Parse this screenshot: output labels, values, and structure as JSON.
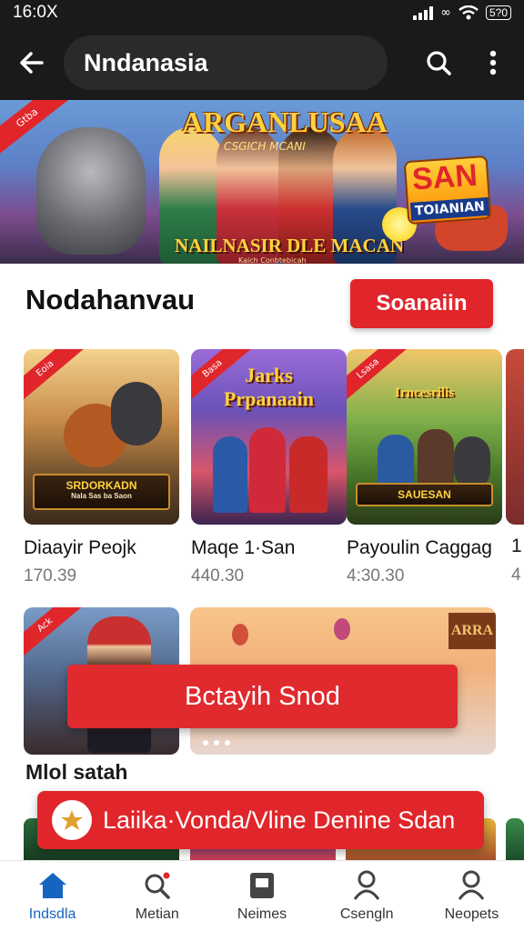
{
  "status_bar": {
    "time": "16:0X",
    "battery": "5?0"
  },
  "app_bar": {
    "title": "Nndanasia",
    "icons": [
      "back-arrow-icon",
      "search-icon",
      "more-vert-icon"
    ]
  },
  "hero_banner": {
    "title": "ARGANLUSAA",
    "subtitle": "CSGICH MCANI",
    "bottom_text": "NAILNASIR DLE MACAN",
    "small_text": "Kaich Conbtebicah",
    "badge_top": "SAN",
    "badge_bottom": "TOIANIAN",
    "corner": "Gtba"
  },
  "section": {
    "title": "Nodahanvau",
    "see_all_label": "Soanaiin"
  },
  "games": [
    {
      "name": "Diaayir Peojk",
      "price": "170.39",
      "corner": "Eoia",
      "caption": "",
      "plate": "SRDORKADN",
      "plate_sub": "Nala Sas ba Saon"
    },
    {
      "name": "Maqe 1·San",
      "price": "440.30",
      "corner": "Basa",
      "caption": "Jarks Prpanaain",
      "plate": "",
      "plate_sub": ""
    },
    {
      "name": "Payoulin Caggag",
      "price": "4:30.30",
      "corner": "Lsasa",
      "caption": "Irncesrilis",
      "plate": "SAUESAN",
      "plate_sub": ""
    },
    {
      "name": "1",
      "price": "4"
    }
  ],
  "promo_row": {
    "corner": "Ack",
    "right_sign": "ARRA"
  },
  "overlay_banner": {
    "label": "Bctayih Snod"
  },
  "subsection": {
    "title": "Mlol satah"
  },
  "cta": {
    "label": "Laiika·Vonda/Vline Denine Sdan"
  },
  "bottom_nav": [
    {
      "label": "Indsdla",
      "icon": "home-icon",
      "active": true
    },
    {
      "label": "Metian",
      "icon": "search-badge-icon",
      "active": false
    },
    {
      "label": "Neimes",
      "icon": "gamepad-icon",
      "active": false
    },
    {
      "label": "Csengln",
      "icon": "person-icon",
      "active": false
    },
    {
      "label": "Neopets",
      "icon": "account-icon",
      "active": false
    }
  ],
  "colors": {
    "accent": "#e0262b",
    "nav_active": "#1565c0",
    "dark_bar": "#1a1a1a"
  }
}
